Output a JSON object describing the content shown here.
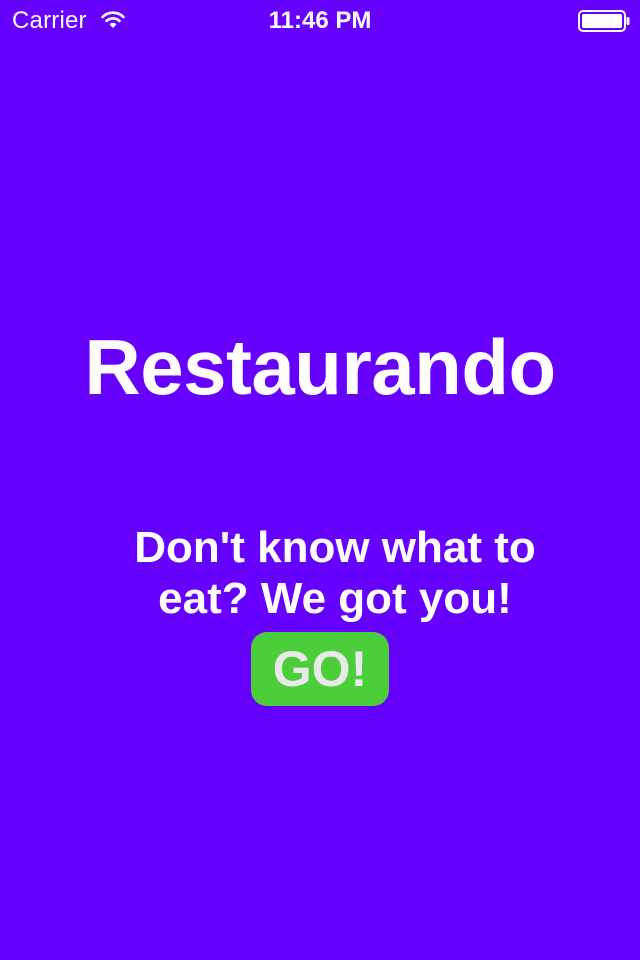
{
  "status_bar": {
    "carrier": "Carrier",
    "time": "11:46 PM",
    "icons": [
      "wifi-icon",
      "battery-icon"
    ]
  },
  "main": {
    "title": "Restaurando",
    "tagline": "Don't know what to eat? We got you!",
    "go_button_label": "GO!"
  },
  "colors": {
    "background": "#6600ff",
    "text": "#ffffff",
    "go_button": "#4ccd3a",
    "go_button_text": "#e9e9e9"
  }
}
